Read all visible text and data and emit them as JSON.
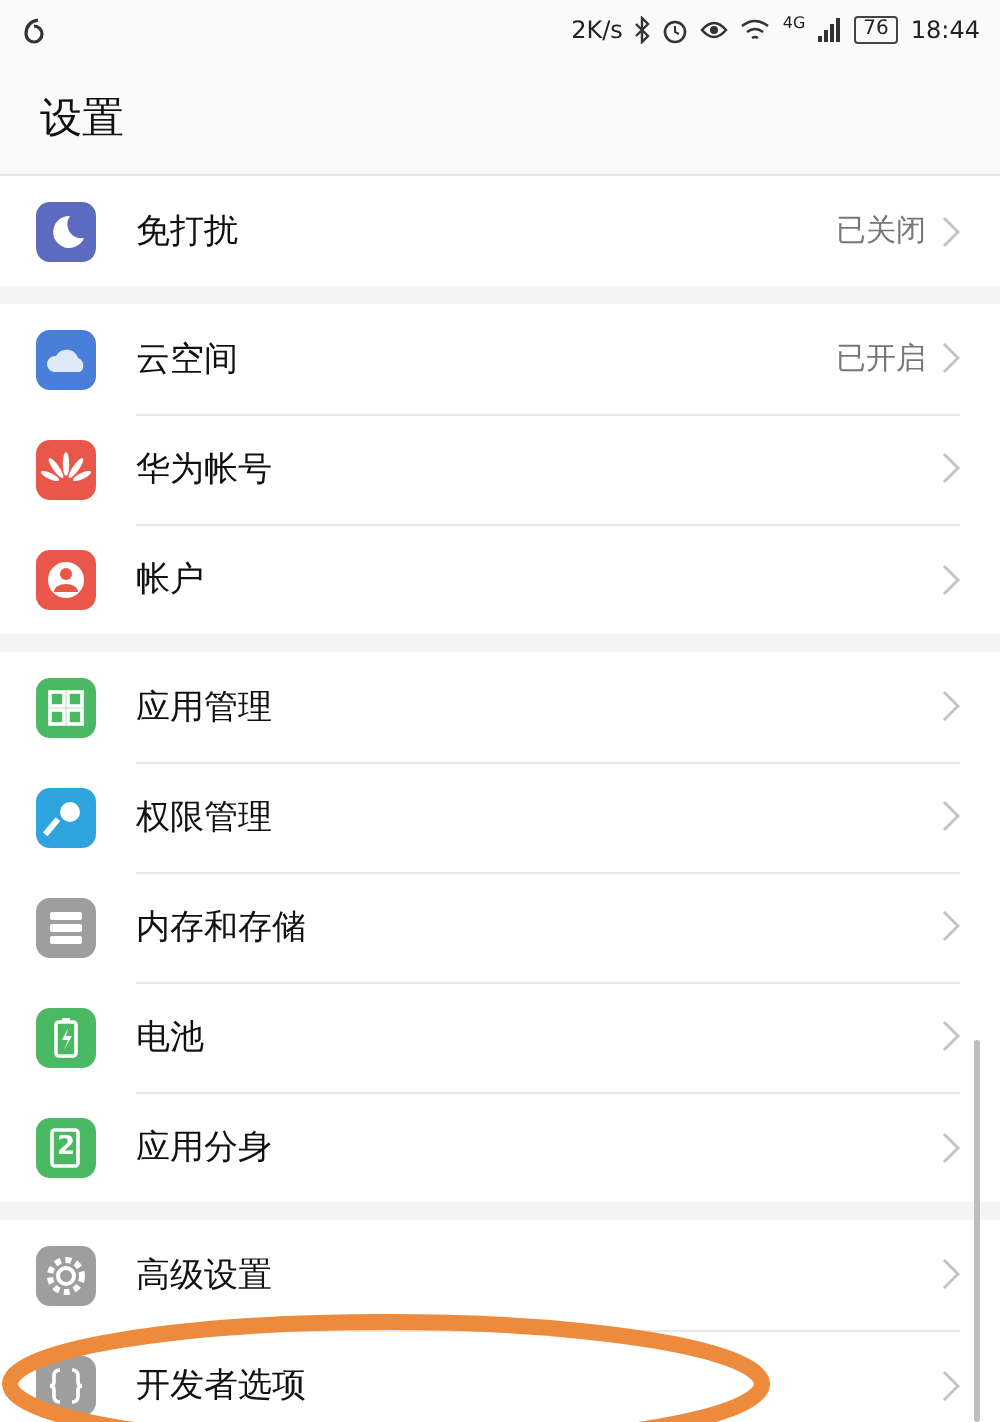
{
  "status_bar": {
    "speed": "2K/s",
    "network": "4G",
    "battery": "76",
    "time": "18:44"
  },
  "title": "设置",
  "groups": [
    {
      "items": [
        {
          "kind": "moon",
          "color": "#5c6bc0",
          "label": "免打扰",
          "value": "已关闭"
        }
      ]
    },
    {
      "items": [
        {
          "kind": "cloud",
          "color": "#4a7fd9",
          "label": "云空间",
          "value": "已开启"
        },
        {
          "kind": "petals",
          "color": "#e9574a",
          "label": "华为帐号"
        },
        {
          "kind": "person",
          "color": "#e9574a",
          "label": "帐户"
        }
      ]
    },
    {
      "items": [
        {
          "kind": "grid",
          "color": "#4bb863",
          "label": "应用管理"
        },
        {
          "kind": "key",
          "color": "#2ea4de",
          "label": "权限管理"
        },
        {
          "kind": "storage",
          "color": "#9e9e9e",
          "label": "内存和存储"
        },
        {
          "kind": "battery",
          "color": "#4bb863",
          "label": "电池"
        },
        {
          "kind": "clone",
          "color": "#4bb863",
          "label": "应用分身",
          "icon_text": "2"
        }
      ]
    },
    {
      "items": [
        {
          "kind": "gear",
          "color": "#9e9e9e",
          "label": "高级设置"
        },
        {
          "kind": "braces",
          "color": "#9e9e9e",
          "label": "开发者选项"
        }
      ]
    }
  ],
  "annotation": {
    "kind": "ellipse",
    "color": "#ee8a3c"
  }
}
